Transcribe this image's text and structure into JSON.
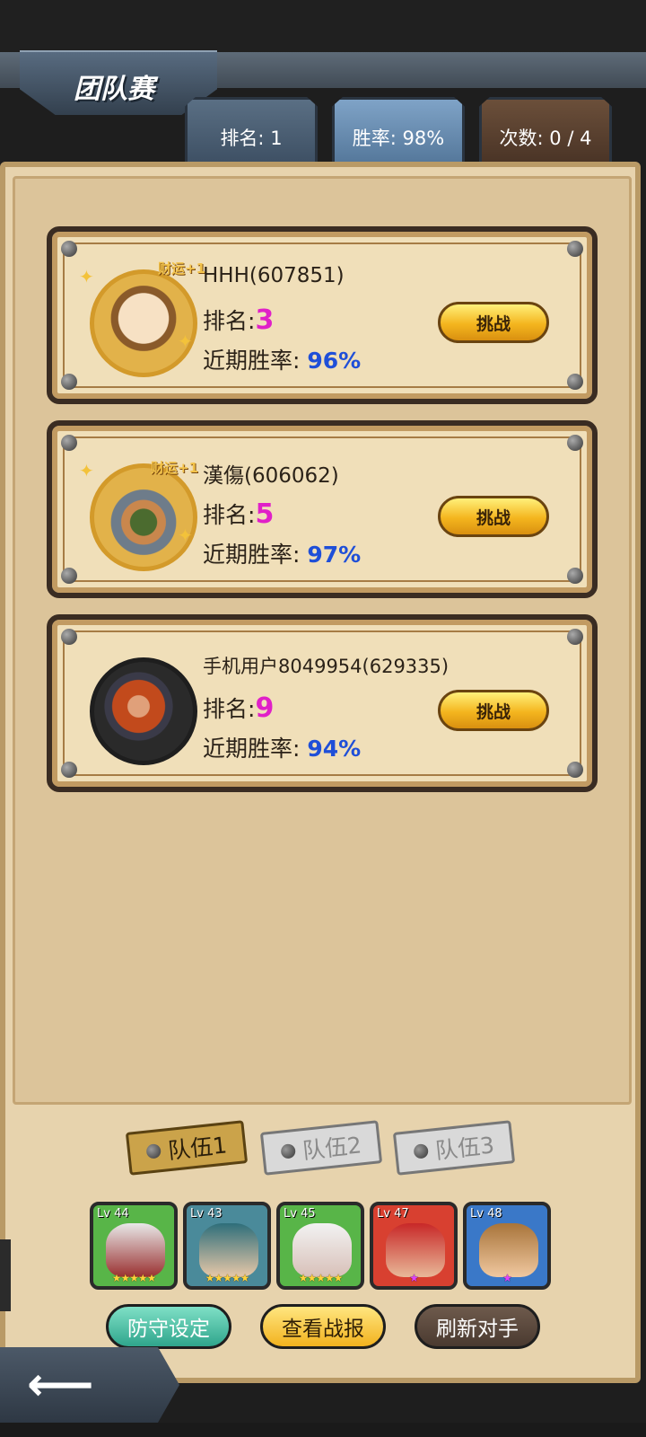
{
  "header": {
    "title": "团队赛",
    "stats": [
      {
        "label": "排名: 1"
      },
      {
        "label": "胜率: 98%"
      },
      {
        "label": "次数: 0 / 4"
      }
    ]
  },
  "opponents": [
    {
      "name": "HHH(607851)",
      "bonus": "财运+1",
      "rank_label": "排名:",
      "rank": "3",
      "rate_label": "近期胜率:",
      "rate": "96%",
      "button": "挑战"
    },
    {
      "name": "漢傷(606062)",
      "bonus": "财运+1",
      "rank_label": "排名:",
      "rank": "5",
      "rate_label": "近期胜率:",
      "rate": "97%",
      "button": "挑战"
    },
    {
      "name": "手机用户8049954(629335)",
      "rank_label": "排名:",
      "rank": "9",
      "rate_label": "近期胜率:",
      "rate": "94%",
      "button": "挑战"
    }
  ],
  "teams": [
    {
      "label": "队伍1"
    },
    {
      "label": "队伍2"
    },
    {
      "label": "队伍3"
    }
  ],
  "heroes": [
    {
      "level": "Lv 44",
      "stars": "★★★★★",
      "bg": "#58b548"
    },
    {
      "level": "Lv 43",
      "stars": "★★★★★",
      "bg": "#4a8a9a"
    },
    {
      "level": "Lv 45",
      "stars": "★★★★★",
      "bg": "#58b548"
    },
    {
      "level": "Lv 47",
      "stars": "★",
      "bg": "#d84030"
    },
    {
      "level": "Lv 48",
      "stars": "★",
      "bg": "#3a78c8"
    }
  ],
  "actions": {
    "defense": "防守设定",
    "reports": "查看战报",
    "refresh": "刷新对手"
  },
  "colors": {
    "rank_value": "#e020c8",
    "rate_value": "#1f4fd8",
    "button_gold": "#f4b51e"
  }
}
